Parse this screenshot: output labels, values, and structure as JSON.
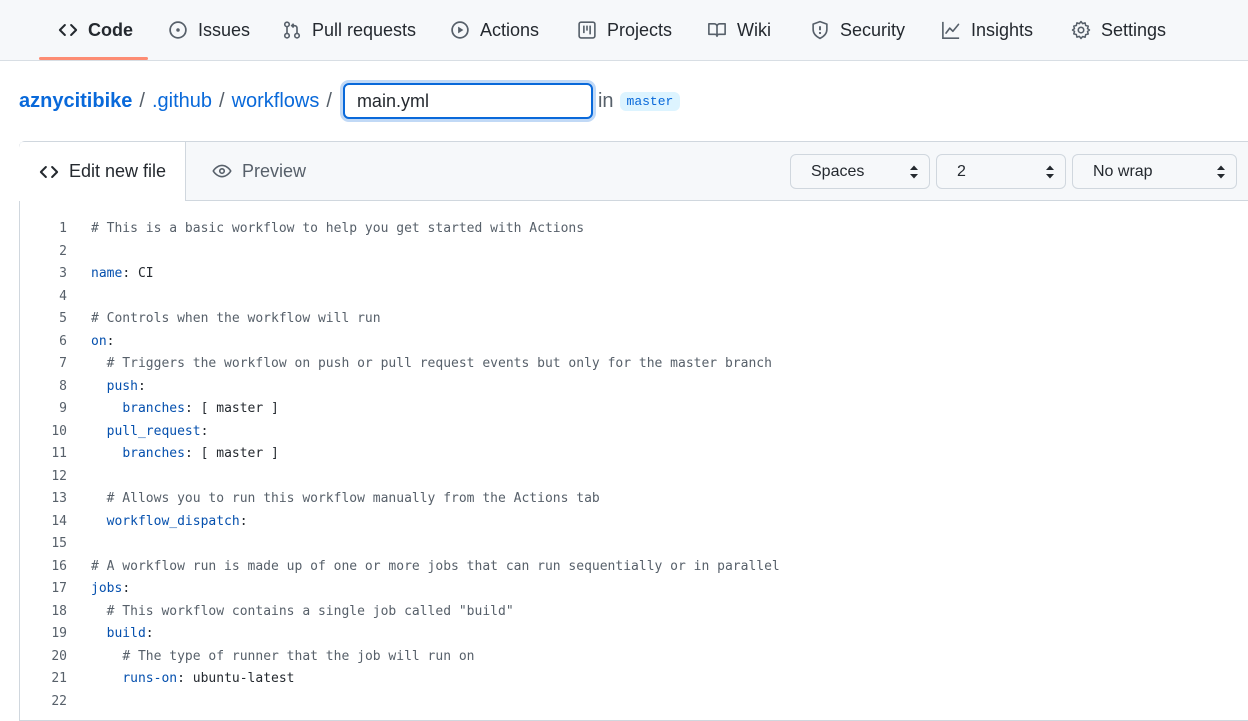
{
  "nav": {
    "tabs": [
      {
        "label": "Code",
        "icon": "code-icon"
      },
      {
        "label": "Issues",
        "icon": "issue-opened-icon"
      },
      {
        "label": "Pull requests",
        "icon": "git-pull-request-icon"
      },
      {
        "label": "Actions",
        "icon": "play-icon"
      },
      {
        "label": "Projects",
        "icon": "table-icon"
      },
      {
        "label": "Wiki",
        "icon": "book-icon"
      },
      {
        "label": "Security",
        "icon": "shield-icon"
      },
      {
        "label": "Insights",
        "icon": "graph-icon"
      },
      {
        "label": "Settings",
        "icon": "gear-icon"
      }
    ],
    "selected": "Code",
    "accent": "#fd8c73"
  },
  "breadcrumb": {
    "repo": "aznycitibike",
    "folders": [
      ".github",
      "workflows"
    ],
    "separator": "/",
    "filename": "main.yml",
    "in_label": "in",
    "branch": "master"
  },
  "editor": {
    "tab_edit": "Edit new file",
    "tab_preview": "Preview",
    "indent_mode": "Spaces",
    "indent_size": "2",
    "wrap_mode": "No wrap",
    "lines": [
      [
        {
          "t": "# This is a basic workflow to help you get started with Actions",
          "c": "c"
        }
      ],
      [],
      [
        {
          "t": "name",
          "c": "k"
        },
        {
          "t": ": CI"
        }
      ],
      [],
      [
        {
          "t": "# Controls when the workflow will run",
          "c": "c"
        }
      ],
      [
        {
          "t": "on",
          "c": "k"
        },
        {
          "t": ":"
        }
      ],
      [
        {
          "t": "  "
        },
        {
          "t": "# Triggers the workflow on push or pull request events but only for the master branch",
          "c": "c"
        }
      ],
      [
        {
          "t": "  "
        },
        {
          "t": "push",
          "c": "k"
        },
        {
          "t": ":"
        }
      ],
      [
        {
          "t": "    "
        },
        {
          "t": "branches",
          "c": "k"
        },
        {
          "t": ": [ master ]"
        }
      ],
      [
        {
          "t": "  "
        },
        {
          "t": "pull_request",
          "c": "k"
        },
        {
          "t": ":"
        }
      ],
      [
        {
          "t": "    "
        },
        {
          "t": "branches",
          "c": "k"
        },
        {
          "t": ": [ master ]"
        }
      ],
      [],
      [
        {
          "t": "  "
        },
        {
          "t": "# Allows you to run this workflow manually from the Actions tab",
          "c": "c"
        }
      ],
      [
        {
          "t": "  "
        },
        {
          "t": "workflow_dispatch",
          "c": "k"
        },
        {
          "t": ":"
        }
      ],
      [],
      [
        {
          "t": "# A workflow run is made up of one or more jobs that can run sequentially or in parallel",
          "c": "c"
        }
      ],
      [
        {
          "t": "jobs",
          "c": "k"
        },
        {
          "t": ":"
        }
      ],
      [
        {
          "t": "  "
        },
        {
          "t": "# This workflow contains a single job called \"build\"",
          "c": "c"
        }
      ],
      [
        {
          "t": "  "
        },
        {
          "t": "build",
          "c": "k"
        },
        {
          "t": ":"
        }
      ],
      [
        {
          "t": "    "
        },
        {
          "t": "# The type of runner that the job will run on",
          "c": "c"
        }
      ],
      [
        {
          "t": "    "
        },
        {
          "t": "runs-on",
          "c": "k"
        },
        {
          "t": ": ubuntu-latest"
        }
      ],
      []
    ]
  }
}
